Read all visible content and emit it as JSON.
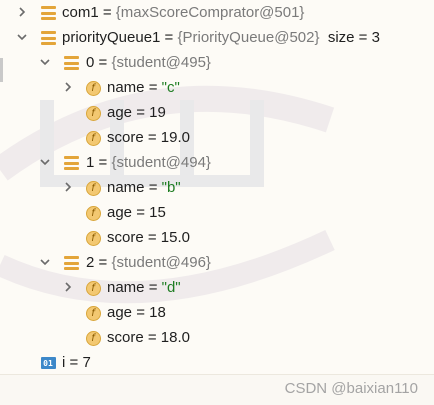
{
  "debugger": {
    "variables": [
      {
        "name": "com1",
        "eq": " = ",
        "value": "{maxScoreComprator@501}",
        "suffix": ""
      },
      {
        "name": "priorityQueue1",
        "eq": " = ",
        "value": "{PriorityQueue@502}",
        "suffix": "size = 3"
      }
    ],
    "elements": [
      {
        "index": "0",
        "eq": " = ",
        "value": "{student@495}",
        "fields": [
          {
            "name": "name",
            "eq": " = ",
            "value": "\"c\"",
            "kind": "string"
          },
          {
            "name": "age",
            "eq": " = ",
            "value": "19",
            "kind": "number"
          },
          {
            "name": "score",
            "eq": " = ",
            "value": "19.0",
            "kind": "number"
          }
        ]
      },
      {
        "index": "1",
        "eq": " = ",
        "value": "{student@494}",
        "fields": [
          {
            "name": "name",
            "eq": " = ",
            "value": "\"b\"",
            "kind": "string"
          },
          {
            "name": "age",
            "eq": " = ",
            "value": "15",
            "kind": "number"
          },
          {
            "name": "score",
            "eq": " = ",
            "value": "15.0",
            "kind": "number"
          }
        ]
      },
      {
        "index": "2",
        "eq": " = ",
        "value": "{student@496}",
        "fields": [
          {
            "name": "name",
            "eq": " = ",
            "value": "\"d\"",
            "kind": "string"
          },
          {
            "name": "age",
            "eq": " = ",
            "value": "18",
            "kind": "number"
          },
          {
            "name": "score",
            "eq": " = ",
            "value": "18.0",
            "kind": "number"
          }
        ]
      }
    ],
    "primitive": {
      "name": "i",
      "eq": " = ",
      "value": "7",
      "icon_text": "01"
    },
    "field_icon_text": "f"
  },
  "watermark": {
    "text": "CSDN @baixian110"
  },
  "colors": {
    "string": "#1e7d22",
    "objref": "#7a7a7a",
    "field_icon": "#f3c871",
    "object_icon": "#e3a53a",
    "primitive_icon": "#3d88c9"
  }
}
